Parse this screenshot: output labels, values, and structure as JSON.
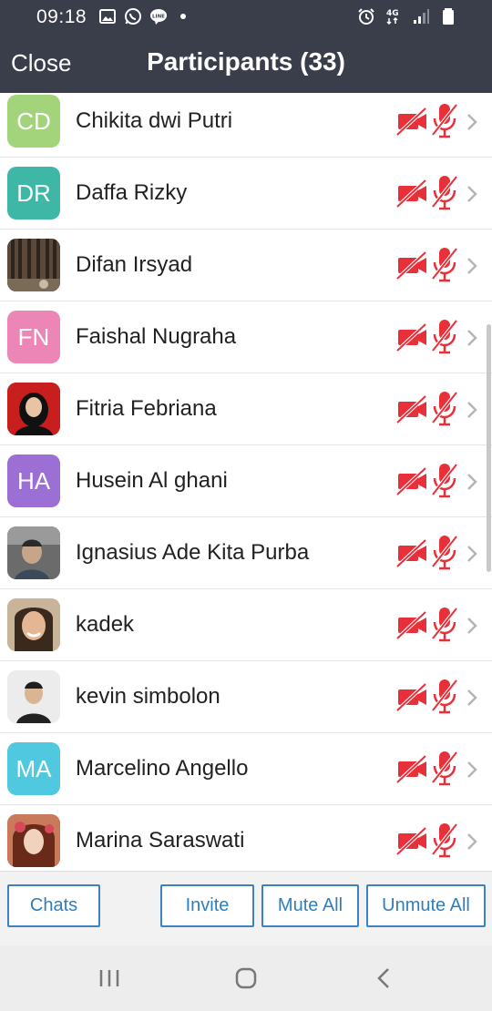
{
  "status_bar": {
    "time": "09:18",
    "network": "4G"
  },
  "header": {
    "close_label": "Close",
    "title": "Participants (33)"
  },
  "participants": [
    {
      "initials": "CD",
      "name": "Chikita dwi Putri",
      "color": "#a3d47c",
      "photo": false
    },
    {
      "initials": "DR",
      "name": "Daffa Rizky",
      "color": "#3fb7a6",
      "photo": false
    },
    {
      "initials": "",
      "name": "Difan Irsyad",
      "color": "#4a3b2f",
      "photo": true
    },
    {
      "initials": "FN",
      "name": "Faishal Nugraha",
      "color": "#ec86b6",
      "photo": false
    },
    {
      "initials": "",
      "name": "Fitria Febriana",
      "color": "#c81e1e",
      "photo": true
    },
    {
      "initials": "HA",
      "name": "Husein Al ghani",
      "color": "#9b6fd3",
      "photo": false
    },
    {
      "initials": "",
      "name": "Ignasius Ade Kita Purba",
      "color": "#5a5a5a",
      "photo": true
    },
    {
      "initials": "",
      "name": "kadek",
      "color": "#b58a62",
      "photo": true
    },
    {
      "initials": "",
      "name": "kevin simbolon",
      "color": "#e8e8e8",
      "photo": true
    },
    {
      "initials": "MA",
      "name": "Marcelino Angello",
      "color": "#4fc8e0",
      "photo": false
    },
    {
      "initials": "",
      "name": "Marina Saraswati",
      "color": "#8a4a3a",
      "photo": true
    }
  ],
  "toolbar": {
    "chats_label": "Chats",
    "invite_label": "Invite",
    "mute_all_label": "Mute All",
    "unmute_all_label": "Unmute All"
  },
  "colors": {
    "header_bg": "#3a3d4a",
    "accent": "#2d7fc1",
    "muted_red": "#e8303a"
  }
}
